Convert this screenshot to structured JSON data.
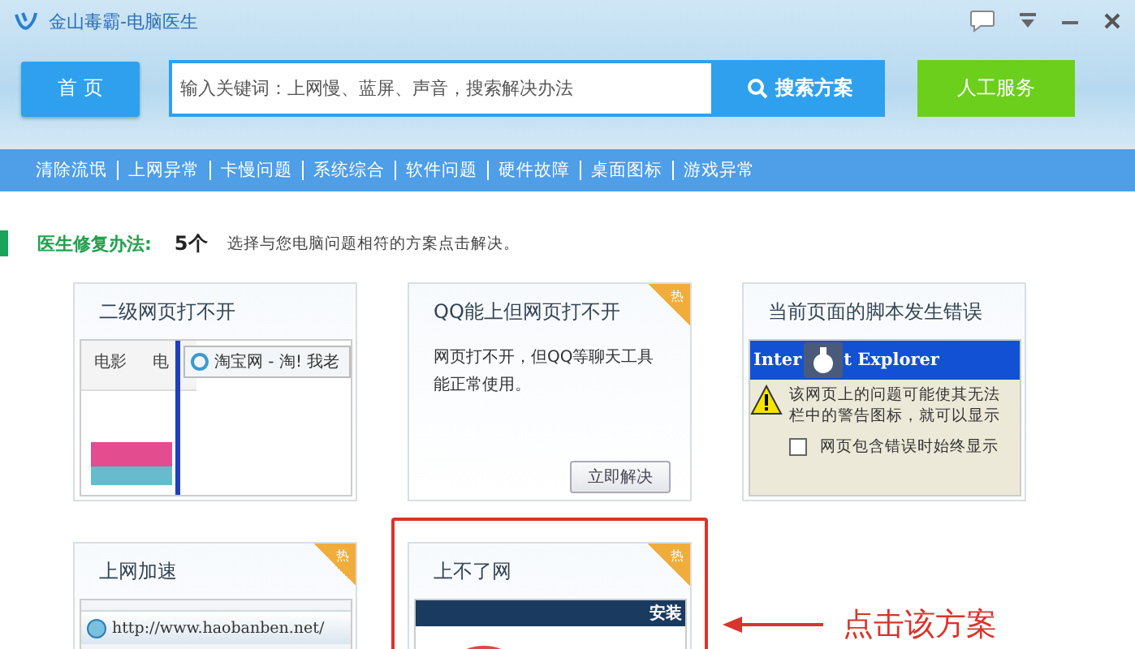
{
  "window": {
    "title": "金山毒霸-电脑医生"
  },
  "home_button": {
    "label": "首 页"
  },
  "search": {
    "placeholder": "输入关键词：上网慢、蓝屏、声音，搜索解决办法",
    "button": "搜索方案"
  },
  "service_button": {
    "label": "人工服务"
  },
  "categories": [
    {
      "label": "清除流氓"
    },
    {
      "label": "上网异常"
    },
    {
      "label": "卡慢问题"
    },
    {
      "label": "系统综合"
    },
    {
      "label": "软件问题"
    },
    {
      "label": "硬件故障"
    },
    {
      "label": "桌面图标"
    },
    {
      "label": "游戏异常"
    }
  ],
  "summary": {
    "label": "医生修复办法:",
    "count": "5个",
    "hint": "选择与您电脑问题相符的方案点击解决。"
  },
  "solutions": [
    {
      "kind": "browser",
      "title": "二级网页打不开",
      "highlighted": false,
      "tabs": [
        "电影",
        "电"
      ],
      "page_tab": "淘宝网 - 淘! 我老"
    },
    {
      "kind": "text",
      "title": "QQ能上但网页打不开",
      "badge": "热",
      "highlighted": false,
      "description": "网页打不开，但QQ等聊天工具能正常使用。",
      "button": "立即解决"
    },
    {
      "kind": "dialog",
      "title": "当前页面的脚本发生错误",
      "highlighted": false,
      "dialog_title": [
        "Inter",
        "t Explorer"
      ],
      "message": [
        "该网页上的问题可能使其无法",
        "栏中的警告图标，就可以显示"
      ],
      "checkbox": {
        "label": "网页包含错误时始终显示",
        "checked": false
      }
    },
    {
      "kind": "address",
      "title": "上网加速",
      "badge": "热",
      "highlighted": false,
      "url": "http://www.haobanben.net/"
    },
    {
      "kind": "install",
      "title": "上不了网",
      "badge": "热",
      "highlighted": true,
      "banner": "安装"
    }
  ],
  "annotation": {
    "text": "点击该方案"
  }
}
